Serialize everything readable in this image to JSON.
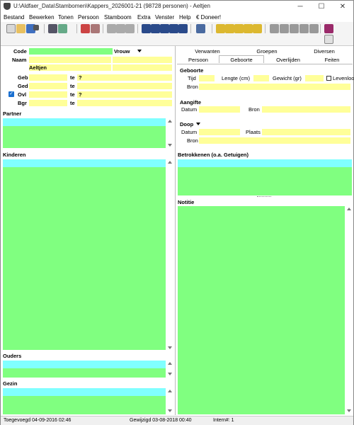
{
  "window": {
    "title": "U:\\Aldfaer_Data\\Stambomen\\Kappers_2026001-21 (98728 personen) - Aeltjen",
    "minimize": "─",
    "maximize": "☐",
    "close": "✕"
  },
  "menu": [
    "Bestand",
    "Bewerken",
    "Tonen",
    "Persoon",
    "Stamboom",
    "Extra",
    "Venster",
    "Help",
    "€ Doneer!"
  ],
  "person": {
    "code_label": "Code",
    "gender": "Vrouw",
    "naam_label": "Naam",
    "voornaam": "Aeltjen",
    "events": [
      {
        "label": "Geb",
        "te": "te",
        "mark": "?"
      },
      {
        "label": "Ged",
        "te": "te",
        "mark": ""
      },
      {
        "label": "Ovl",
        "te": "te",
        "mark": "?"
      },
      {
        "label": "Bgr",
        "te": "te",
        "mark": ""
      }
    ]
  },
  "sections": {
    "partner": "Partner",
    "kinderen": "Kinderen",
    "ouders": "Ouders",
    "gezin": "Gezin",
    "betrokkenen": "Betrokkenen (o.a. Getuigen)",
    "notitie": "Notitie"
  },
  "tabs_row1": [
    "Verwanten",
    "Groepen",
    "Diversen"
  ],
  "tabs_row2": [
    "Persoon",
    "Geboorte",
    "Overlijden",
    "Feiten"
  ],
  "geboorte": {
    "title": "Geboorte",
    "tijd": "Tijd",
    "lengte": "Lengte (cm)",
    "gewicht": "Gewicht (gr)",
    "levenloos": "Levenloos",
    "bron": "Bron"
  },
  "aangifte": {
    "title": "Aangifte",
    "datum": "Datum",
    "bron": "Bron"
  },
  "doop": {
    "title": "Doop",
    "datum": "Datum",
    "plaats": "Plaats",
    "bron": "Bron"
  },
  "status": {
    "toegevoegd": "Toegevoegd 04-09-2016 02:46",
    "gewijzigd": "Gewijzigd 03-08-2018 00:40",
    "intern": "Intern#: 1"
  }
}
